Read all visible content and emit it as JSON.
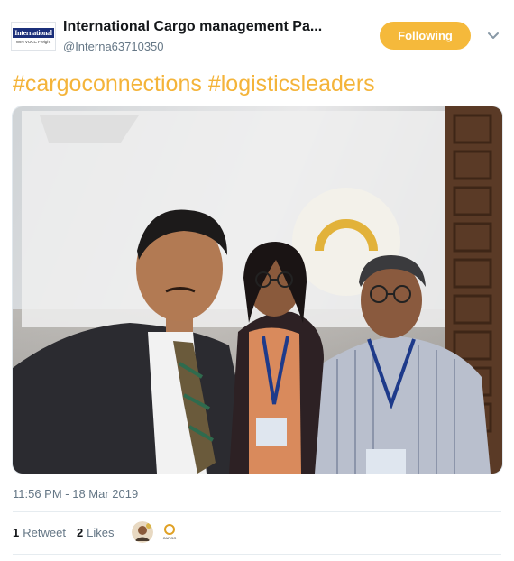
{
  "tweet": {
    "author_name": "International Cargo management Pa...",
    "author_handle": "@Interna63710350",
    "avatar_logo_text": "International",
    "avatar_logo_subtext": "WIN VOCC Freight",
    "follow_button_label": "Following",
    "hashtags": [
      "#cargoconnections",
      "#logisticsleaders"
    ],
    "timestamp": "11:56 PM - 18 Mar 2019",
    "retweet_count": "1",
    "retweet_label": "Retweet",
    "likes_count": "2",
    "likes_label": "Likes",
    "liker_avatar_2_text": "CARGO"
  },
  "colors": {
    "accent": "#f5b93b",
    "hashtag": "#f4b43a",
    "secondary_text": "#657786"
  },
  "icons": {
    "more_menu": "chevron-down-icon"
  }
}
